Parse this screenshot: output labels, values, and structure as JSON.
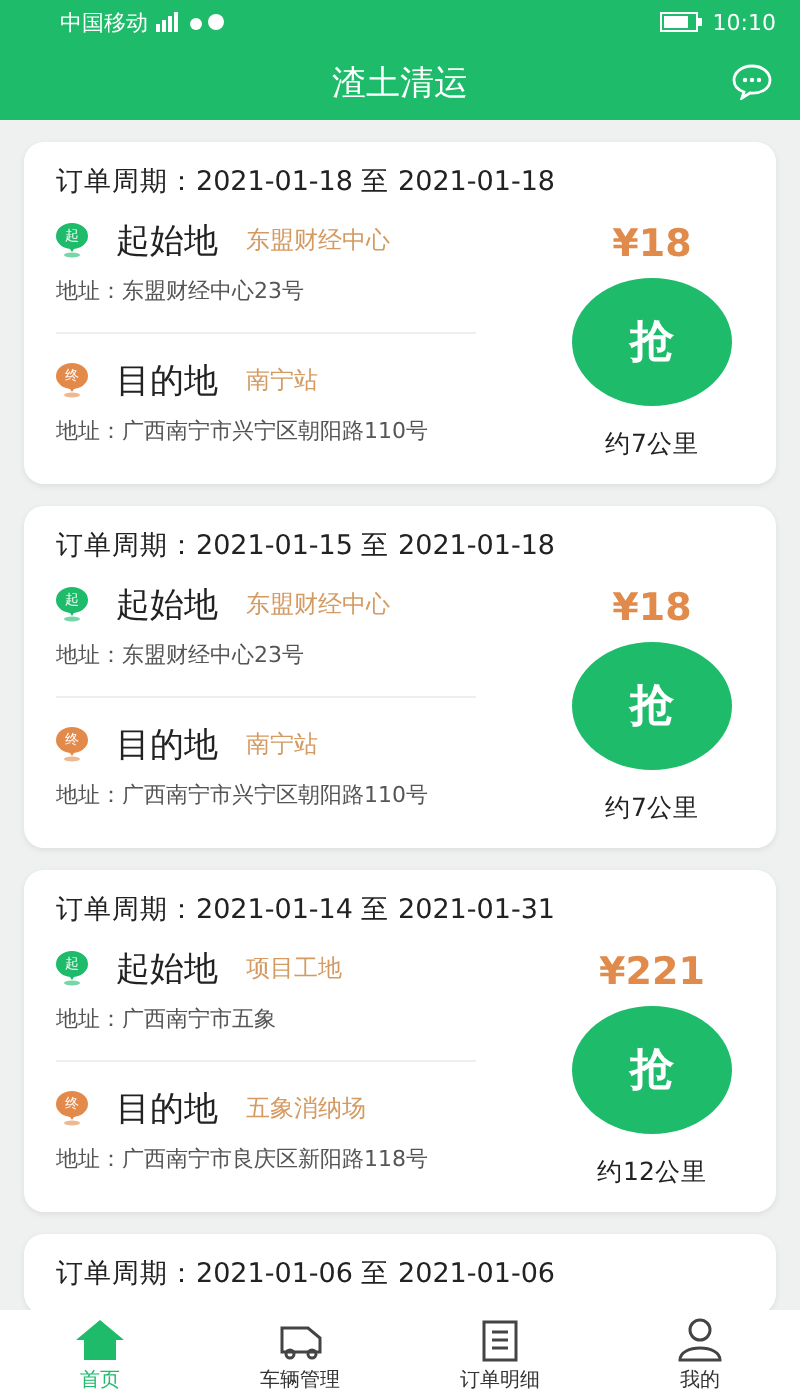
{
  "status_bar": {
    "carrier": "中国移动",
    "time": "10:10"
  },
  "header": {
    "title": "渣土清运"
  },
  "orders": [
    {
      "period": "订单周期：2021-01-18 至 2021-01-18",
      "start": {
        "pin": "起",
        "label": "起始地",
        "place": "东盟财经中心",
        "address": "地址：东盟财经中心23号"
      },
      "end": {
        "pin": "终",
        "label": "目的地",
        "place": "南宁站",
        "address": "地址：广西南宁市兴宁区朝阳路110号"
      },
      "price": "¥18",
      "grab": "抢",
      "distance": "约7公里"
    },
    {
      "period": "订单周期：2021-01-15 至 2021-01-18",
      "start": {
        "pin": "起",
        "label": "起始地",
        "place": "东盟财经中心",
        "address": "地址：东盟财经中心23号"
      },
      "end": {
        "pin": "终",
        "label": "目的地",
        "place": "南宁站",
        "address": "地址：广西南宁市兴宁区朝阳路110号"
      },
      "price": "¥18",
      "grab": "抢",
      "distance": "约7公里"
    },
    {
      "period": "订单周期：2021-01-14 至 2021-01-31",
      "start": {
        "pin": "起",
        "label": "起始地",
        "place": "项目工地",
        "address": "地址：广西南宁市五象"
      },
      "end": {
        "pin": "终",
        "label": "目的地",
        "place": "五象消纳场",
        "address": "地址：广西南宁市良庆区新阳路118号"
      },
      "price": "¥221",
      "grab": "抢",
      "distance": "约12公里"
    },
    {
      "period": "订单周期：2021-01-06 至 2021-01-06"
    }
  ],
  "tabs": [
    {
      "kind": "home",
      "label": "首页",
      "selected": true
    },
    {
      "kind": "truck",
      "label": "车辆管理",
      "selected": false
    },
    {
      "kind": "list",
      "label": "订单明细",
      "selected": false
    },
    {
      "kind": "user",
      "label": "我的",
      "selected": false
    }
  ]
}
